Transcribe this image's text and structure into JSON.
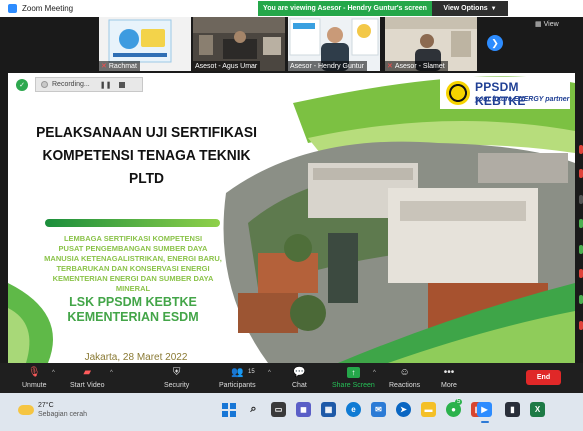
{
  "window": {
    "title": "Zoom Meeting"
  },
  "banner": {
    "viewing_text": "You are viewing Asesor - Hendry Guntur's screen",
    "view_options": "View Options"
  },
  "gallery": {
    "view_label": "View",
    "participants": [
      {
        "name": "Rachmat",
        "muted": true
      },
      {
        "name": "Asesot - Agus Umar",
        "muted": false
      },
      {
        "name": "Asesor - Hendry Guntur",
        "muted": false
      },
      {
        "name": "Asesor - Slamet",
        "muted": true
      }
    ]
  },
  "recording": {
    "label": "Recording..."
  },
  "slide": {
    "title_lines": [
      "PELAKSANAAN UJI SERTIFIKASI",
      "KOMPETENSI TENAGA TEKNIK",
      "PLTD"
    ],
    "org_lines": [
      "LEMBAGA SERTIFIKASI KOMPETENSI",
      "PUSAT PENGEMBANGAN SUMBER DAYA",
      "MANUSIA KETENAGALISTRIKAN, ENERGI BARU,",
      "TERBARUKAN DAN KONSERVASI ENERGI",
      "KEMENTERIAN ENERGI DAN SUMBER DAYA",
      "MINERAL"
    ],
    "lsk_lines": [
      "LSK PPSDM KEBTKE",
      "KEMENTERIAN ESDM"
    ],
    "date": "Jakarta, 28 Maret 2022",
    "logo_title": "PPSDM KEBTKE",
    "logo_tagline": "your future ENERGY partner"
  },
  "toolbar": {
    "unmute": "Unmute",
    "start_video": "Start Video",
    "security": "Security",
    "participants": "Participants",
    "participants_count": "15",
    "chat": "Chat",
    "share_screen": "Share Screen",
    "reactions": "Reactions",
    "more": "More",
    "end": "End"
  },
  "taskbar": {
    "temperature": "27°C",
    "condition": "Sebagian cerah",
    "notif_count": "5"
  },
  "colors": {
    "accent": "#2d8cff",
    "share_green": "#25a74a",
    "end_red": "#e02828",
    "slide_green": "#43a548"
  }
}
